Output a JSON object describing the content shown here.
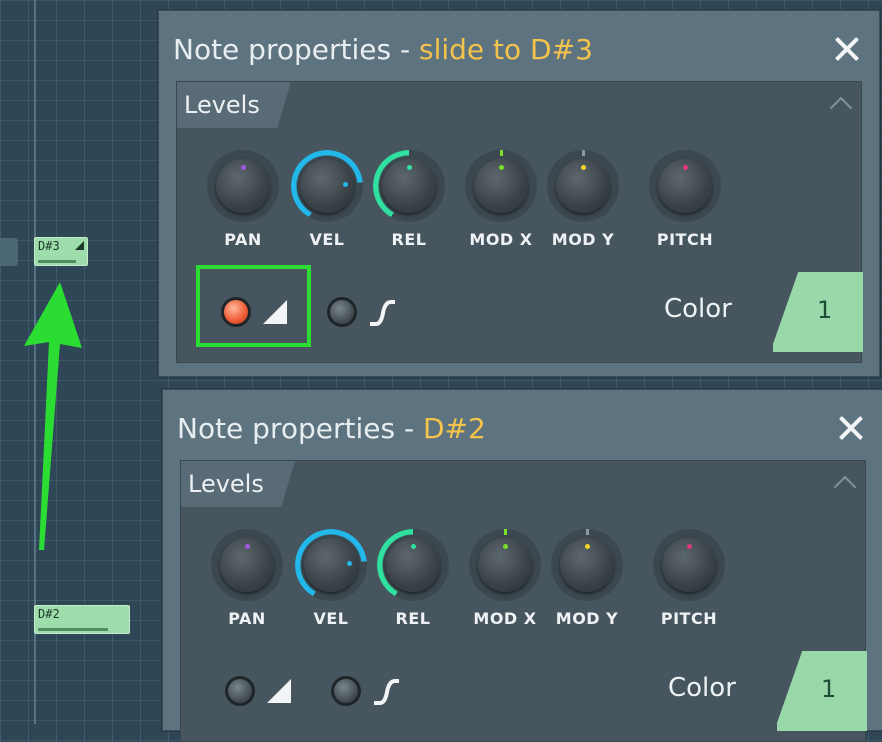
{
  "piano_roll": {
    "notes": [
      {
        "label": "D#3",
        "slide": true
      },
      {
        "label": "D#2",
        "slide": false
      }
    ]
  },
  "panels": [
    {
      "title_prefix": "Note properties - ",
      "note_name": "slide to D#3",
      "tab": "Levels",
      "knobs": [
        {
          "label": "PAN",
          "dot_color": "#a15be0",
          "value": 0.5
        },
        {
          "label": "VEL",
          "dot_color": "#23b8ea",
          "value": 0.78,
          "arc_color": "#23b8ea"
        },
        {
          "label": "REL",
          "dot_color": "#2fe0a0",
          "value": 0.5,
          "arc_color": "#2fe0a0"
        },
        {
          "label": "MOD X",
          "dot_color": "#79e02a",
          "value": 0.5
        },
        {
          "label": "MOD Y",
          "dot_color": "#f3d52a",
          "value": 0.5
        },
        {
          "label": "PITCH",
          "dot_color": "#e0387a",
          "value": 0.5
        }
      ],
      "slide_on": true,
      "porta_on": false,
      "color_label": "Color",
      "color_value": "1",
      "color_swatch": "#98d8a9"
    },
    {
      "title_prefix": "Note properties - ",
      "note_name": "D#2",
      "tab": "Levels",
      "knobs": [
        {
          "label": "PAN",
          "dot_color": "#a15be0",
          "value": 0.5
        },
        {
          "label": "VEL",
          "dot_color": "#23b8ea",
          "value": 0.78,
          "arc_color": "#23b8ea"
        },
        {
          "label": "REL",
          "dot_color": "#2fe0a0",
          "value": 0.5,
          "arc_color": "#2fe0a0"
        },
        {
          "label": "MOD X",
          "dot_color": "#79e02a",
          "value": 0.5
        },
        {
          "label": "MOD Y",
          "dot_color": "#f3d52a",
          "value": 0.5
        },
        {
          "label": "PITCH",
          "dot_color": "#e0387a",
          "value": 0.5
        }
      ],
      "slide_on": false,
      "porta_on": false,
      "color_label": "Color",
      "color_value": "1",
      "color_swatch": "#98d8a9"
    }
  ],
  "annotations": {
    "highlight_color": "#2bdd33",
    "arrow_color": "#2bdd33"
  }
}
